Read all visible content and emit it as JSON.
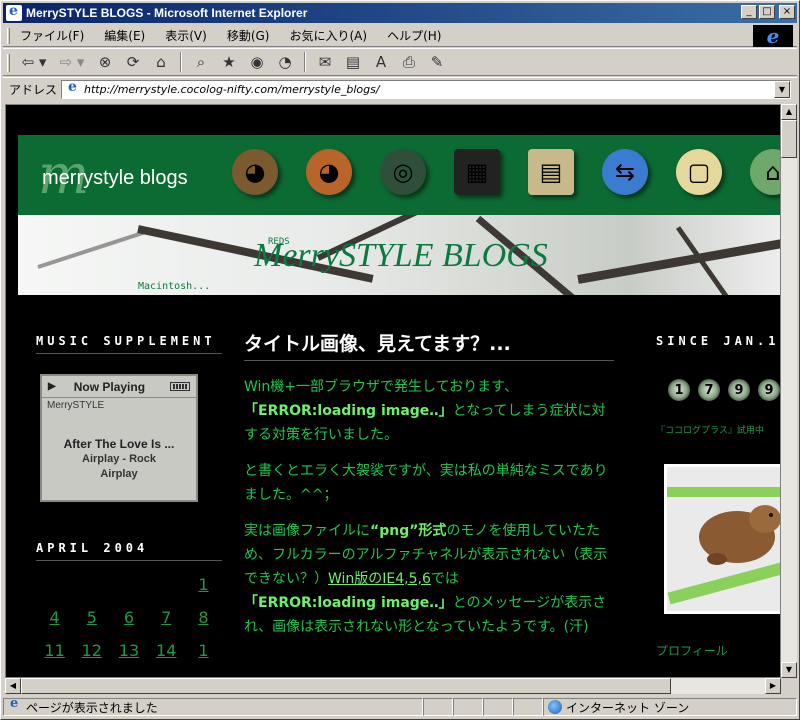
{
  "window": {
    "title": "MerrySTYLE BLOGS - Microsoft Internet Explorer",
    "min_label": "_",
    "max_label": "□",
    "close_label": "×"
  },
  "menu": [
    "ファイル(F)",
    "編集(E)",
    "表示(V)",
    "移動(G)",
    "お気に入り(A)",
    "ヘルプ(H)"
  ],
  "address": {
    "label": "アドレス",
    "url": "http://merrystyle.cocolog-nifty.com/merrystyle_blogs/"
  },
  "banner": {
    "logo_mark": "m",
    "logo_text": "merrystyle blogs",
    "strip_title": "MerrySTYLE BLOGS",
    "strip_small_top": "REDS",
    "strip_small_bottom": "Macintosh..."
  },
  "sidebar_left": {
    "music_heading": "MUSIC SUPPLEMENT",
    "player_now": "Now Playing",
    "player_sub": "MerrySTYLE",
    "player_track": "After The Love Is ...",
    "player_artist": "Airplay - Rock",
    "player_album": "Airplay",
    "calendar_heading": "APRIL 2004",
    "calendar_rows": [
      [
        "",
        "",
        "",
        "",
        "1"
      ],
      [
        "4",
        "5",
        "6",
        "7",
        "8"
      ],
      [
        "11",
        "12",
        "13",
        "14",
        "1"
      ]
    ]
  },
  "post": {
    "title": "タイトル画像、見えてます？...",
    "p1_a": "Win機+一部ブラウザで発生しております、",
    "p1_b": "「ERROR:loading image‥」",
    "p1_c": "となってしまう症状に対する対策を行いました。",
    "p2": "と書くとエラく大袈裟ですが、実は私の単純なミスでありました。^^；",
    "p3_a": "実は画像ファイルに",
    "p3_b": "“png”形式",
    "p3_c": "のモノを使用していたため、フルカラーのアルファチャネルが表示されない（表示できない？）",
    "p3_link": "Win版のIE4,5,6",
    "p3_d": "では",
    "p3_e": "「ERROR:loading image‥」",
    "p3_f": "とのメッセージが表示され、画像は表示されない形となっていたようです。(汗)"
  },
  "sidebar_right": {
    "since_heading": "SINCE JAN.17,2004",
    "counter": [
      "1",
      "7",
      "9",
      "9"
    ],
    "cocolog_link": "『ココログプラス』試用中",
    "profile_label": "プロフィール"
  },
  "status": {
    "text": "ページが表示されました",
    "zone": "インターネット ゾーン"
  },
  "colors": {
    "banner_green": "#0c6b33",
    "text_green": "#18c94e",
    "highlight_green": "#6ef06a"
  }
}
